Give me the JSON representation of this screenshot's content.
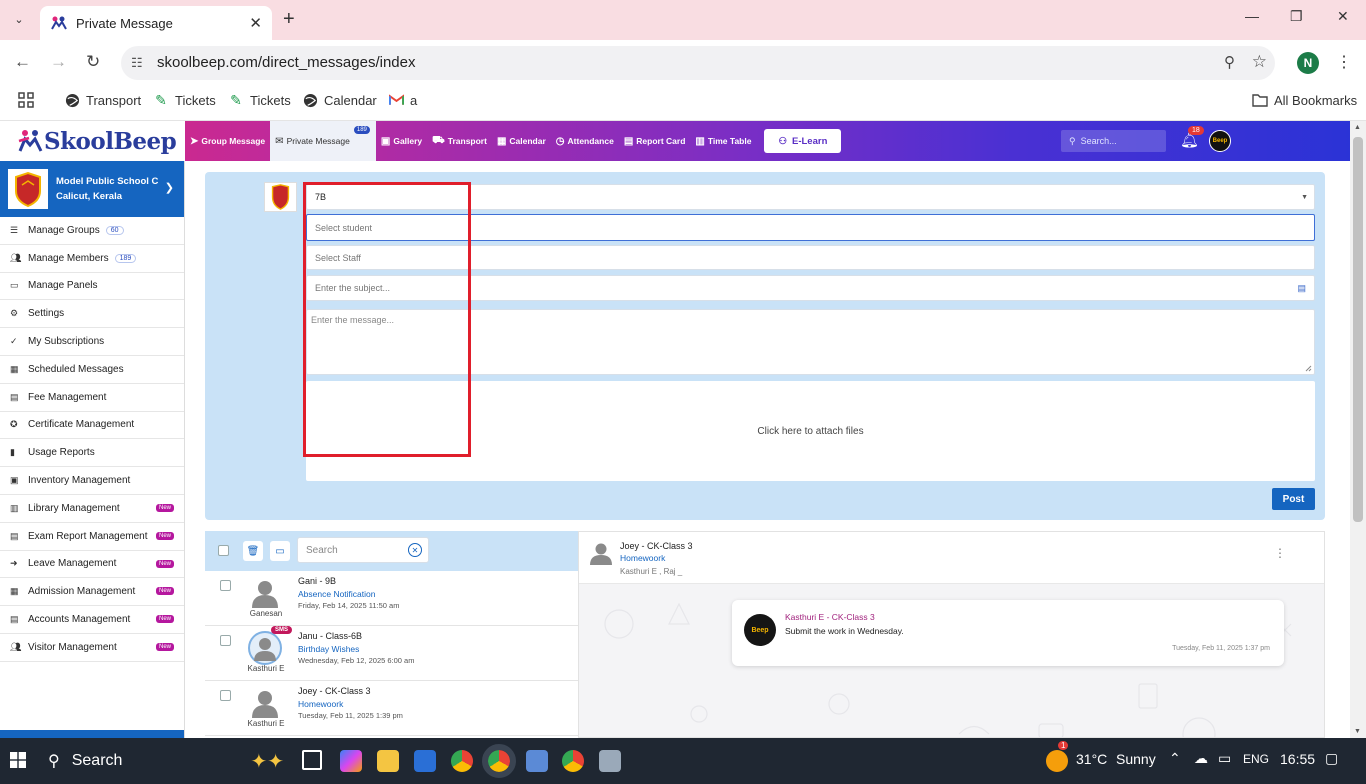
{
  "browser": {
    "tab_title": "Private Message",
    "url": "skoolbeep.com/direct_messages/index",
    "profile_initial": "N",
    "bookmarks": [
      "Transport",
      "Tickets",
      "Tickets",
      "Calendar",
      "a"
    ],
    "all_bookmarks": "All Bookmarks"
  },
  "header": {
    "brand": "SkoolBeep",
    "menu": [
      {
        "label": "Group Message",
        "icon": "paper-plane-icon"
      },
      {
        "label": "Private Message",
        "icon": "envelope-icon",
        "badge": "189"
      },
      {
        "label": "Gallery",
        "icon": "image-icon"
      },
      {
        "label": "Transport",
        "icon": "bus-icon"
      },
      {
        "label": "Calendar",
        "icon": "calendar-icon"
      },
      {
        "label": "Attendance",
        "icon": "clock-icon"
      },
      {
        "label": "Report Card",
        "icon": "report-icon"
      },
      {
        "label": "Time Table",
        "icon": "timetable-icon"
      }
    ],
    "elearn": "E-Learn",
    "search_placeholder": "Search...",
    "notification_count": "18"
  },
  "sidebar": {
    "school_name": "Model Public School C",
    "school_location": "Calicut, Kerala",
    "items": [
      {
        "label": "Manage Groups",
        "icon": "list-icon",
        "count": "60"
      },
      {
        "label": "Manage Members",
        "icon": "users-icon",
        "count": "189"
      },
      {
        "label": "Manage Panels",
        "icon": "monitor-icon"
      },
      {
        "label": "Settings",
        "icon": "gear-icon"
      },
      {
        "label": "My Subscriptions",
        "icon": "check-icon"
      },
      {
        "label": "Scheduled Messages",
        "icon": "calendar-icon"
      },
      {
        "label": "Fee Management",
        "icon": "file-icon"
      },
      {
        "label": "Certificate Management",
        "icon": "award-icon"
      },
      {
        "label": "Usage Reports",
        "icon": "bar-chart-icon"
      },
      {
        "label": "Inventory Management",
        "icon": "box-icon"
      },
      {
        "label": "Library Management",
        "icon": "book-icon",
        "tag": "New"
      },
      {
        "label": "Exam Report Management",
        "icon": "exam-icon",
        "tag": "New"
      },
      {
        "label": "Leave Management",
        "icon": "leave-icon",
        "tag": "New"
      },
      {
        "label": "Admission Management",
        "icon": "admission-icon",
        "tag": "New"
      },
      {
        "label": "Accounts Management",
        "icon": "accounts-icon",
        "tag": "New"
      },
      {
        "label": "Visitor Management",
        "icon": "visitors-icon",
        "tag": "New"
      }
    ]
  },
  "compose": {
    "class_value": "7B",
    "student_placeholder": "Select student",
    "staff_placeholder": "Select Staff",
    "subject_placeholder": "Enter the subject...",
    "message_placeholder": "Enter the message...",
    "attach_label": "Click here to attach files",
    "post_label": "Post"
  },
  "list": {
    "search_placeholder": "Search",
    "rows": [
      {
        "from": "Gani - 9B",
        "subject": "Absence Notification",
        "date": "Friday, Feb 14, 2025 11:50 am",
        "author": "Ganesan"
      },
      {
        "from": "Janu - Class-6B",
        "subject": "Birthday Wishes",
        "date": "Wednesday, Feb 12, 2025 6:00 am",
        "author": "Kasthuri E",
        "tag": "SMS"
      },
      {
        "from": "Joey - CK-Class 3",
        "subject": "Homewoork",
        "date": "Tuesday, Feb 11, 2025 1:39 pm",
        "author": "Kasthuri E"
      }
    ]
  },
  "conversation": {
    "title": "Joey - CK-Class 3",
    "subject": "Homewoork",
    "recipients": "Kasthuri E , Raj _",
    "message": {
      "sender": "Kasthuri E - CK-Class 3",
      "text": "Submit the work in Wednesday.",
      "time": "Tuesday, Feb 11, 2025 1:37 pm"
    }
  },
  "taskbar": {
    "search_label": "Search",
    "weather_temp": "31°C",
    "weather_text": "Sunny",
    "weather_badge": "1",
    "language": "ENG",
    "time": "16:55"
  },
  "colors": {
    "primary": "#1565c0",
    "header_start": "#e0267a",
    "header_end": "#2b33d6",
    "highlight_box": "#e01e2b"
  }
}
